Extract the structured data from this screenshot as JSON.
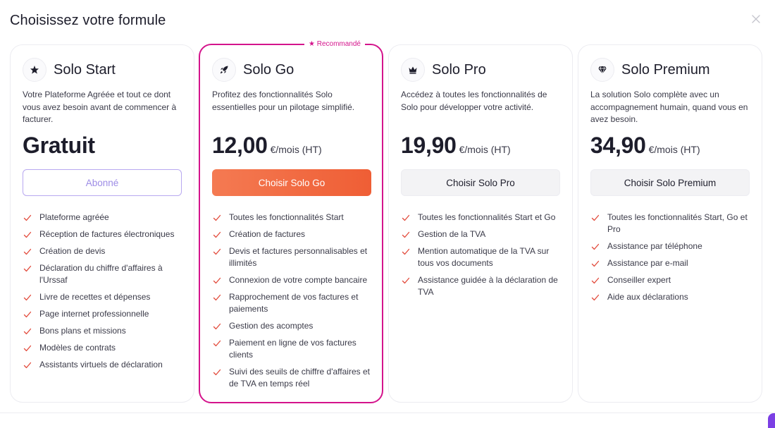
{
  "modal": {
    "title": "Choisissez votre formule"
  },
  "colors": {
    "accent_pink": "#d4148c",
    "cta_orange": "#f26b42",
    "check_red": "#e24a3b",
    "subscribed_purple": "#9d8ce6"
  },
  "plans": [
    {
      "name": "Solo Start",
      "icon": "star-icon",
      "description": "Votre Plateforme Agréée et tout ce dont vous avez besoin avant de commencer à facturer.",
      "price": "Gratuit",
      "price_unit": "",
      "cta": "Abonné",
      "features": [
        "Plateforme agréée",
        "Réception de factures électroniques",
        "Création de devis",
        "Déclaration du chiffre d'affaires à l'Urssaf",
        "Livre de recettes et dépenses",
        "Page internet professionnelle",
        "Bons plans et missions",
        "Modèles de contrats",
        "Assistants virtuels de déclaration"
      ]
    },
    {
      "name": "Solo Go",
      "icon": "rocket-icon",
      "badge": "★ Recommandé",
      "description": "Profitez des fonctionnalités Solo essentielles pour un pilotage simplifié.",
      "price": "12,00",
      "price_unit": "€/mois (HT)",
      "cta": "Choisir Solo Go",
      "features": [
        "Toutes les fonctionnalités Start",
        "Création de factures",
        "Devis et factures personnalisables et illimités",
        "Connexion de votre compte bancaire",
        "Rapprochement de vos factures et paiements",
        "Gestion des acomptes",
        "Paiement en ligne de vos factures clients",
        "Suivi des seuils de chiffre d'affaires et de TVA en temps réel"
      ]
    },
    {
      "name": "Solo Pro",
      "icon": "crown-icon",
      "description": "Accédez à toutes les fonctionnalités de Solo pour développer votre activité.",
      "price": "19,90",
      "price_unit": "€/mois (HT)",
      "cta": "Choisir Solo Pro",
      "features": [
        "Toutes les fonctionnalités Start et Go",
        "Gestion de la TVA",
        "Mention automatique de la TVA sur tous vos documents",
        "Assistance guidée à la déclaration de TVA"
      ]
    },
    {
      "name": "Solo Premium",
      "icon": "diamond-icon",
      "description": "La solution Solo complète avec un accompagnement humain, quand vous en avez besoin.",
      "price": "34,90",
      "price_unit": "€/mois (HT)",
      "cta": "Choisir Solo Premium",
      "features": [
        "Toutes les fonctionnalités Start, Go et Pro",
        "Assistance par téléphone",
        "Assistance par e-mail",
        "Conseiller expert",
        "Aide aux déclarations"
      ]
    }
  ]
}
